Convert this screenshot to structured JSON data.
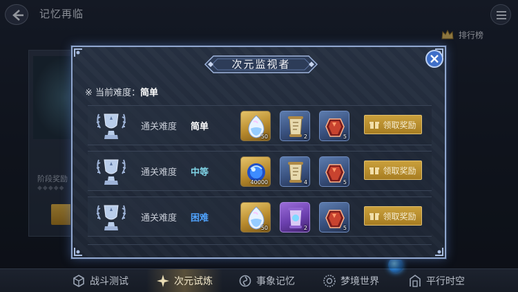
{
  "header": {
    "back_icon": "back-arrow-icon",
    "title": "记忆再临",
    "menu_icon": "hamburger-menu-icon"
  },
  "leaderboard": {
    "icon": "crown-icon",
    "label": "排行榜"
  },
  "left_card": {
    "stage_reward_label": "阶段奖励"
  },
  "dialog": {
    "title": "次元监视者",
    "close_icon": "close-icon",
    "current_difficulty_label": "※ 当前难度：",
    "current_difficulty_value": "简单",
    "rows": [
      {
        "label": "通关难度",
        "difficulty": "简单",
        "difficulty_color": "#ffffff",
        "rewards": [
          {
            "icon": "crystal-icon",
            "rarity": "gold",
            "qty": "50"
          },
          {
            "icon": "scroll-icon",
            "rarity": "blue",
            "qty": "2"
          },
          {
            "icon": "red-gem-icon",
            "rarity": "blue",
            "qty": "5"
          }
        ],
        "claim_label": "领取奖励"
      },
      {
        "label": "通关难度",
        "difficulty": "中等",
        "difficulty_color": "#7fd3e6",
        "rewards": [
          {
            "icon": "blue-orb-icon",
            "rarity": "gold",
            "qty": "40000"
          },
          {
            "icon": "scroll-icon",
            "rarity": "blue",
            "qty": "4"
          },
          {
            "icon": "red-gem-icon",
            "rarity": "blue",
            "qty": "5"
          }
        ],
        "claim_label": "领取奖励"
      },
      {
        "label": "通关难度",
        "difficulty": "困难",
        "difficulty_color": "#4fa3ff",
        "rewards": [
          {
            "icon": "crystal-icon",
            "rarity": "gold",
            "qty": "50"
          },
          {
            "icon": "purple-scroll-icon",
            "rarity": "purple",
            "qty": "2"
          },
          {
            "icon": "red-gem-icon",
            "rarity": "blue",
            "qty": "5"
          }
        ],
        "claim_label": "领取奖励"
      }
    ]
  },
  "bottom_nav": [
    {
      "label": "战斗测试",
      "icon": "cube-icon",
      "active": false
    },
    {
      "label": "次元试炼",
      "icon": "star-compass-icon",
      "active": true
    },
    {
      "label": "事象记忆",
      "icon": "swirl-icon",
      "active": false
    },
    {
      "label": "梦境世界",
      "icon": "seal-icon",
      "active": false
    },
    {
      "label": "平行时空",
      "icon": "portal-gate-icon",
      "active": false
    }
  ],
  "colors": {
    "accent_gold": "#caa03c",
    "frame_blue": "#8fa6cf",
    "close_blue": "#3f6fc8"
  }
}
